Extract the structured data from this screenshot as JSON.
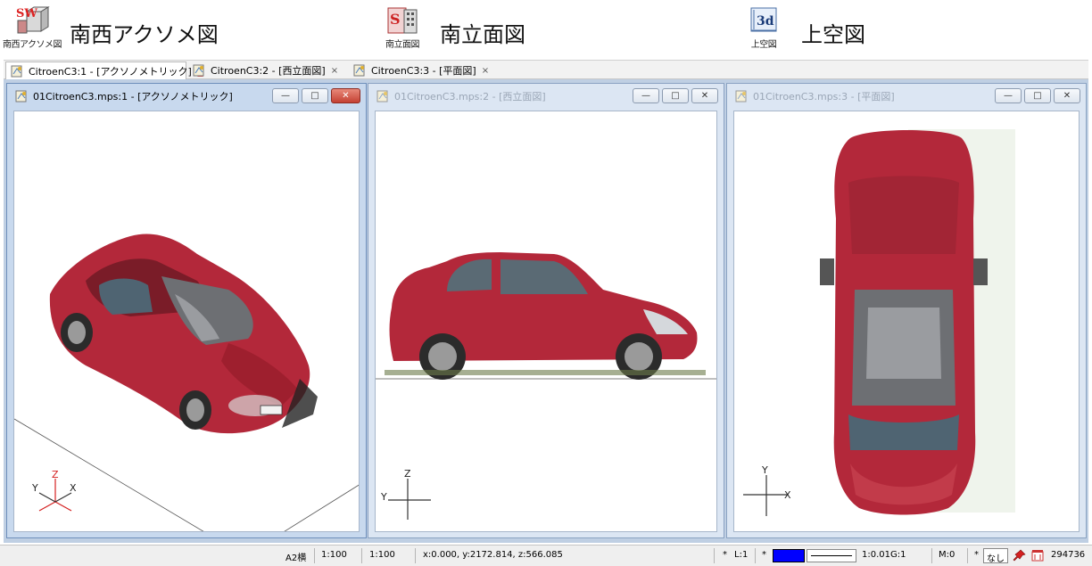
{
  "view_buttons": [
    {
      "icon_caption": "南西アクソメ図",
      "label": "南西アクソメ図",
      "icon": "axonometric-sw-icon"
    },
    {
      "icon_caption": "南立面図",
      "label": "南立面図",
      "icon": "elevation-south-icon"
    },
    {
      "icon_caption": "上空図",
      "label": "上空図",
      "icon": "sky-view-3d-icon",
      "glyph_text": "3d"
    }
  ],
  "tabs": [
    {
      "label": "CitroenC3:1 - [アクソノメトリック]",
      "close": "×",
      "active": true
    },
    {
      "label": "CitroenC3:2 - [西立面図]",
      "close": "×",
      "active": false
    },
    {
      "label": "CitroenC3:3 - [平面図]",
      "close": "×",
      "active": false
    }
  ],
  "windows": [
    {
      "title": "01CitroenC3.mps:1 - [アクソノメトリック]",
      "active": true,
      "controls": {
        "minimize": "—",
        "maximize": "□",
        "close": "✕"
      },
      "axes": {
        "z": "Z",
        "y": "Y",
        "x": "X"
      }
    },
    {
      "title": "01CitroenC3.mps:2 - [西立面図]",
      "active": false,
      "controls": {
        "minimize": "—",
        "maximize": "□",
        "close": "✕"
      },
      "axes": {
        "z": "Z",
        "y": "Y"
      }
    },
    {
      "title": "01CitroenC3.mps:3 - [平面図]",
      "active": false,
      "controls": {
        "minimize": "—",
        "maximize": "□",
        "close": "✕"
      },
      "axes": {
        "y": "Y",
        "x": "X"
      }
    }
  ],
  "status": {
    "paper": "A2横",
    "scale1": "1:100",
    "scale2": "1:100",
    "coords": "x:0.000, y:2172.814, z:566.085",
    "star1": "*",
    "layer": "L:1",
    "star2": "*",
    "line_color": "#0000ff",
    "line_scale": "1:0.01",
    "group": "G:1",
    "mode": "M:0",
    "star3": "*",
    "nashi": "なし",
    "count": "294736"
  },
  "colors": {
    "car_red": "#b3283a",
    "window_frame": "#c8d9ee",
    "axis_red": "#d42020"
  }
}
